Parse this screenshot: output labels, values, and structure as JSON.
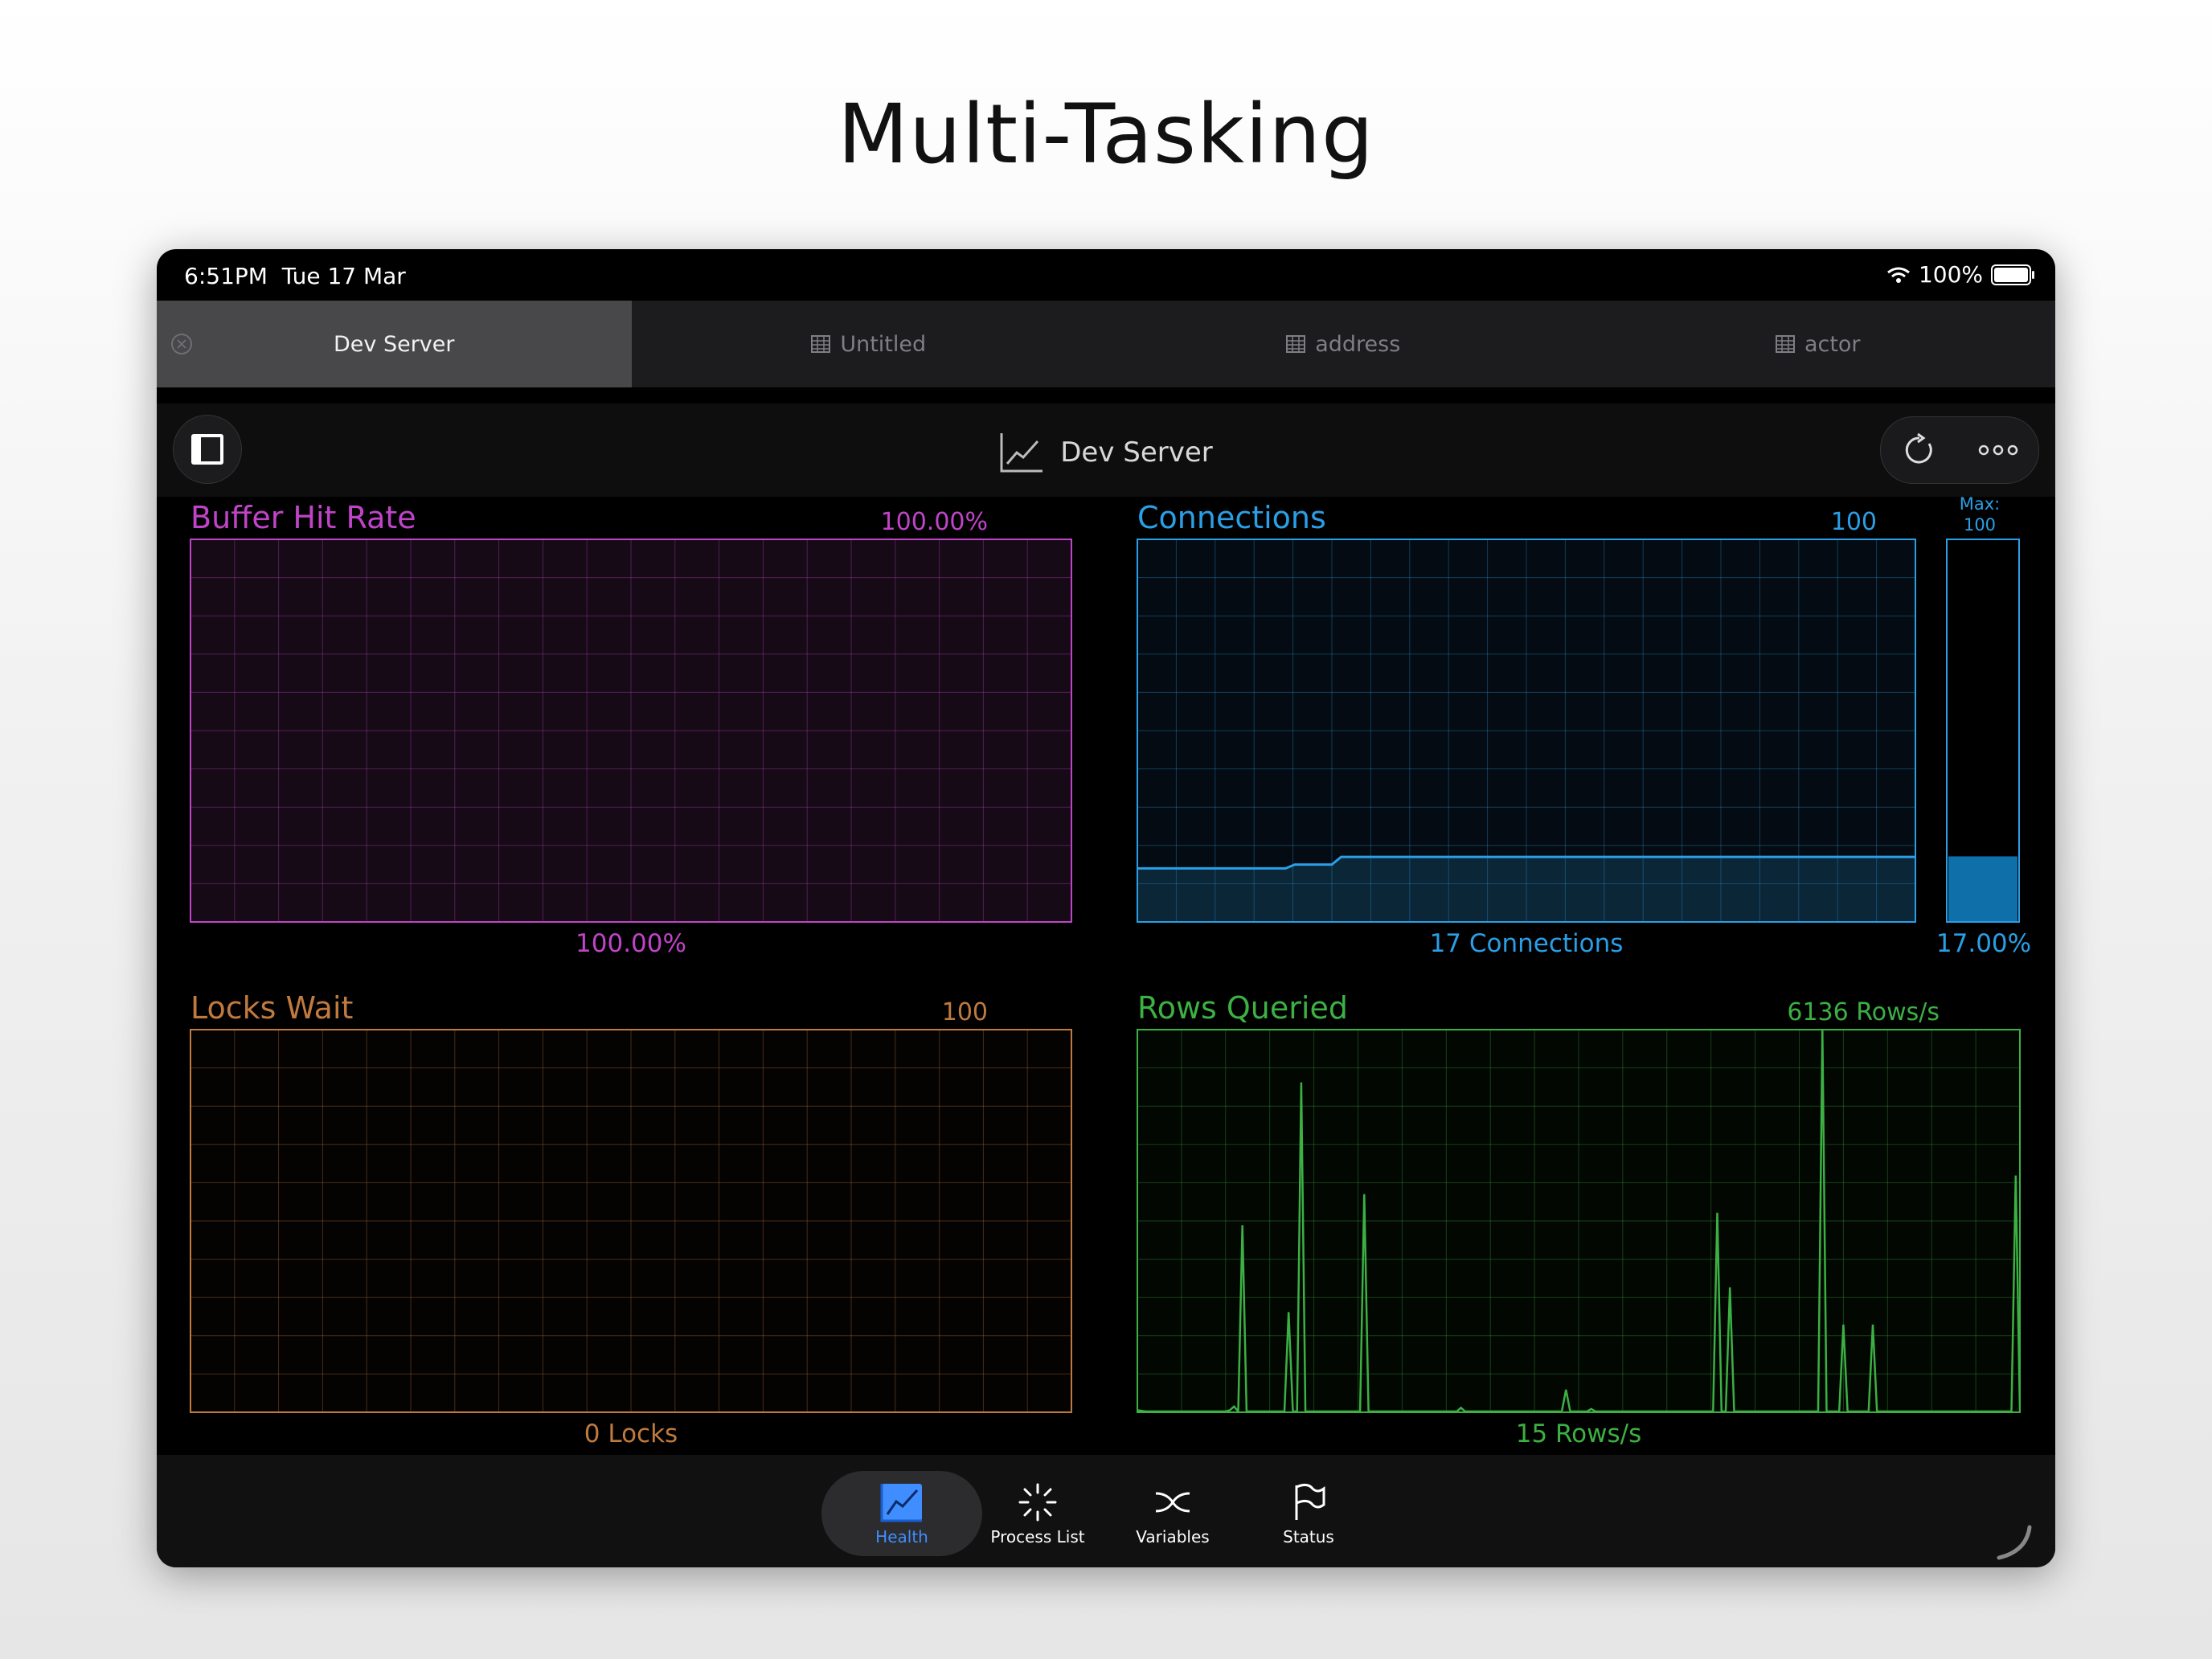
{
  "headline": "Multi-Tasking",
  "status_bar": {
    "time": "6:51PM",
    "date": "Tue 17 Mar",
    "battery": "100%"
  },
  "tabs": [
    {
      "label": "Dev Server",
      "active": true
    },
    {
      "label": "Untitled",
      "icon": "table-icon"
    },
    {
      "label": "address",
      "icon": "table-icon"
    },
    {
      "label": "actor",
      "icon": "table-icon"
    }
  ],
  "nav": {
    "title": "Dev Server",
    "title_icon": "chart-icon"
  },
  "panels": {
    "buffer": {
      "title": "Buffer Hit Rate",
      "top_value": "100.00%",
      "bottom_value": "100.00%",
      "color": "#c044c8"
    },
    "connections": {
      "title": "Connections",
      "top_value": "100",
      "bottom_value": "17 Connections",
      "max_label": "Max:",
      "max_value": "100",
      "gauge_value": "17.00%",
      "color": "#2a9fe6"
    },
    "locks": {
      "title": "Locks Wait",
      "top_value": "100",
      "bottom_value": "0 Locks",
      "color": "#c07a3e"
    },
    "rows": {
      "title": "Rows Queried",
      "top_value": "6136 Rows/s",
      "bottom_value": "15 Rows/s",
      "color": "#3cb043"
    }
  },
  "chart_data": [
    {
      "type": "area",
      "name": "Connections",
      "ylim": [
        0,
        100
      ],
      "values": [
        14,
        14,
        14,
        14,
        14,
        14,
        14,
        14,
        14,
        14,
        14,
        14,
        14,
        14,
        14,
        14,
        14,
        15,
        15,
        15,
        15,
        15,
        17,
        17,
        17,
        17,
        17,
        17,
        17,
        17,
        17,
        17,
        17,
        17,
        17,
        17,
        17,
        17,
        17,
        17,
        17,
        17,
        17,
        17,
        17,
        17,
        17,
        17,
        17,
        17,
        17,
        17,
        17,
        17,
        17,
        17,
        17,
        17,
        17,
        17,
        17,
        17,
        17,
        17,
        17,
        17,
        17,
        17,
        17,
        17,
        17,
        17,
        17,
        17,
        17,
        17,
        17,
        17,
        17,
        17,
        17,
        17,
        17,
        17,
        17
      ]
    },
    {
      "type": "line",
      "name": "Rows Queried",
      "ylim": [
        0,
        6136
      ],
      "values": [
        20,
        10,
        0,
        0,
        0,
        0,
        0,
        0,
        0,
        0,
        0,
        0,
        0,
        0,
        0,
        0,
        0,
        0,
        0,
        0,
        0,
        0,
        20,
        80,
        0,
        3000,
        0,
        0,
        0,
        0,
        0,
        0,
        0,
        0,
        0,
        0,
        1600,
        0,
        0,
        5300,
        0,
        0,
        0,
        0,
        0,
        0,
        0,
        0,
        0,
        0,
        0,
        0,
        0,
        0,
        3500,
        0,
        0,
        0,
        0,
        0,
        0,
        0,
        0,
        0,
        0,
        0,
        0,
        0,
        0,
        0,
        0,
        0,
        0,
        0,
        0,
        0,
        0,
        60,
        0,
        0,
        0,
        0,
        0,
        0,
        0,
        0,
        0,
        0,
        0,
        0,
        0,
        0,
        0,
        0,
        0,
        0,
        0,
        0,
        0,
        0,
        0,
        0,
        350,
        0,
        0,
        0,
        0,
        0,
        40,
        0,
        0,
        0,
        0,
        0,
        0,
        0,
        0,
        0,
        0,
        0,
        0,
        0,
        0,
        0,
        0,
        0,
        0,
        0,
        0,
        0,
        0,
        0,
        0,
        0,
        0,
        0,
        0,
        0,
        3200,
        0,
        0,
        2000,
        0,
        0,
        0,
        0,
        0,
        0,
        0,
        0,
        0,
        0,
        0,
        0,
        0,
        0,
        0,
        0,
        0,
        0,
        0,
        0,
        0,
        7100,
        0,
        0,
        0,
        0,
        1400,
        0,
        0,
        0,
        0,
        0,
        0,
        1400,
        0,
        0,
        0,
        0,
        0,
        0,
        0,
        0,
        0,
        0,
        0,
        0,
        0,
        0,
        0,
        0,
        0,
        0,
        0,
        0,
        0,
        0,
        0,
        0,
        0,
        0,
        0,
        0,
        0,
        0,
        0,
        0,
        0,
        3800,
        0
      ]
    }
  ],
  "bottom_tabs": [
    {
      "label": "Health",
      "icon": "chart-icon",
      "active": true
    },
    {
      "label": "Process List",
      "icon": "spinner-icon"
    },
    {
      "label": "Variables",
      "icon": "variables-icon"
    },
    {
      "label": "Status",
      "icon": "flag-icon"
    }
  ]
}
